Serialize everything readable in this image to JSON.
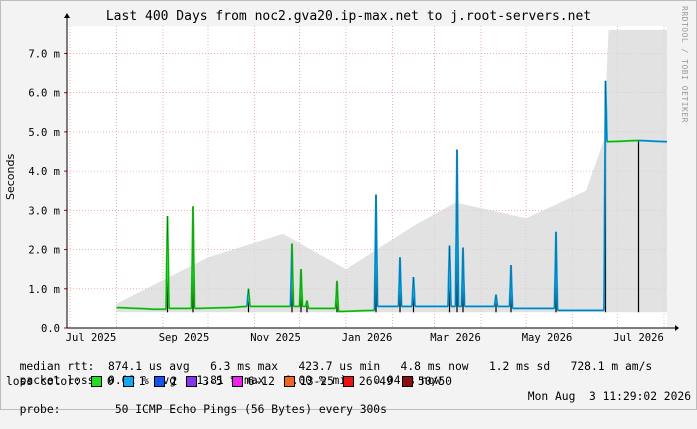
{
  "title": "Last 400 Days from noc2.gva20.ip-max.net to j.root-servers.net",
  "watermark": "RRDTOOL / TOBI OETIKER",
  "stats": {
    "median_rtt": {
      "label": "median rtt:",
      "avg": "874.1 us avg",
      "max": "6.3 ms max",
      "min": "423.7 us min",
      "now": "4.8 ms now",
      "sd": "1.2 ms sd",
      "ams": "728.1 m am/s"
    },
    "packet_loss": {
      "label": "packet loss:",
      "avg": "0.02 % avg",
      "max": "1.81 % max",
      "min": "0.00 % min",
      "now": "0.04 % now"
    }
  },
  "legend": {
    "label": "loss color:",
    "items": [
      {
        "label": "0",
        "color": "#22dd22"
      },
      {
        "label": "1",
        "color": "#11aaee"
      },
      {
        "label": "2",
        "color": "#1155ee"
      },
      {
        "label": "3-5",
        "color": "#8833ee"
      },
      {
        "label": "6-12",
        "color": "#ee22ee"
      },
      {
        "label": "13-25",
        "color": "#ee6622"
      },
      {
        "label": "26-49",
        "color": "#ee1111"
      },
      {
        "label": "50/50",
        "color": "#881111"
      }
    ]
  },
  "probe": {
    "label": "probe:",
    "text": "50 ICMP Echo Pings (56 Bytes) every 300s",
    "date": "Mon Aug  3 11:29:02 2026"
  },
  "chart_data": {
    "type": "line",
    "ylabel": "Seconds",
    "ylim": [
      0,
      7.7
    ],
    "y_unit_scale": 0.001,
    "yticks": [
      {
        "value": 0,
        "label": "0.0"
      },
      {
        "value": 1,
        "label": "1.0 m"
      },
      {
        "value": 2,
        "label": "2.0 m"
      },
      {
        "value": 3,
        "label": "3.0 m"
      },
      {
        "value": 4,
        "label": "4.0 m"
      },
      {
        "value": 5,
        "label": "5.0 m"
      },
      {
        "value": 6,
        "label": "6.0 m"
      },
      {
        "value": 7,
        "label": "7.0 m"
      }
    ],
    "xlim": [
      "2025-06-29",
      "2026-08-03"
    ],
    "xticks": [
      {
        "date": "2025-07-15",
        "label": "Jul 2025"
      },
      {
        "date": "2025-09-15",
        "label": "Sep 2025"
      },
      {
        "date": "2025-11-15",
        "label": "Nov 2025"
      },
      {
        "date": "2026-01-15",
        "label": "Jan 2026"
      },
      {
        "date": "2026-03-15",
        "label": "Mar 2026"
      },
      {
        "date": "2026-05-15",
        "label": "May 2026"
      },
      {
        "date": "2026-07-15",
        "label": "Jul 2026"
      }
    ],
    "grid": true,
    "median_series": [
      {
        "date": "2025-08-01",
        "ms": 0.52,
        "loss": "0"
      },
      {
        "date": "2025-08-15",
        "ms": 0.5,
        "loss": "0"
      },
      {
        "date": "2025-08-25",
        "ms": 0.48,
        "loss": "0"
      },
      {
        "date": "2025-09-03",
        "ms": 0.48,
        "loss": "0"
      },
      {
        "date": "2025-09-04",
        "ms": 2.85,
        "loss": "0"
      },
      {
        "date": "2025-09-05",
        "ms": 0.5,
        "loss": "0"
      },
      {
        "date": "2025-09-20",
        "ms": 0.5,
        "loss": "0"
      },
      {
        "date": "2025-09-21",
        "ms": 3.1,
        "loss": "0"
      },
      {
        "date": "2025-09-22",
        "ms": 0.5,
        "loss": "0"
      },
      {
        "date": "2025-10-15",
        "ms": 0.52,
        "loss": "0"
      },
      {
        "date": "2025-10-27",
        "ms": 0.55,
        "loss": "0"
      },
      {
        "date": "2025-10-28",
        "ms": 1.0,
        "loss": "1"
      },
      {
        "date": "2025-10-29",
        "ms": 0.55,
        "loss": "0"
      },
      {
        "date": "2025-11-25",
        "ms": 0.55,
        "loss": "0"
      },
      {
        "date": "2025-11-26",
        "ms": 2.15,
        "loss": "1"
      },
      {
        "date": "2025-11-27",
        "ms": 0.55,
        "loss": "0"
      },
      {
        "date": "2025-12-01",
        "ms": 0.55,
        "loss": "0"
      },
      {
        "date": "2025-12-02",
        "ms": 1.5,
        "loss": "0"
      },
      {
        "date": "2025-12-03",
        "ms": 0.55,
        "loss": "0"
      },
      {
        "date": "2025-12-05",
        "ms": 0.55,
        "loss": "0"
      },
      {
        "date": "2025-12-06",
        "ms": 0.7,
        "loss": "0"
      },
      {
        "date": "2025-12-07",
        "ms": 0.5,
        "loss": "0"
      },
      {
        "date": "2025-12-25",
        "ms": 0.5,
        "loss": "0"
      },
      {
        "date": "2025-12-26",
        "ms": 1.2,
        "loss": "0"
      },
      {
        "date": "2025-12-27",
        "ms": 0.42,
        "loss": "0"
      },
      {
        "date": "2026-01-20",
        "ms": 0.45,
        "loss": "0"
      },
      {
        "date": "2026-01-21",
        "ms": 3.4,
        "loss": "1"
      },
      {
        "date": "2026-01-22",
        "ms": 0.55,
        "loss": "1"
      },
      {
        "date": "2026-02-05",
        "ms": 0.55,
        "loss": "1"
      },
      {
        "date": "2026-02-06",
        "ms": 1.8,
        "loss": "1"
      },
      {
        "date": "2026-02-07",
        "ms": 0.55,
        "loss": "1"
      },
      {
        "date": "2026-02-14",
        "ms": 0.55,
        "loss": "1"
      },
      {
        "date": "2026-02-15",
        "ms": 1.3,
        "loss": "1"
      },
      {
        "date": "2026-02-16",
        "ms": 0.55,
        "loss": "1"
      },
      {
        "date": "2026-03-10",
        "ms": 0.55,
        "loss": "1"
      },
      {
        "date": "2026-03-11",
        "ms": 2.1,
        "loss": "1"
      },
      {
        "date": "2026-03-12",
        "ms": 0.55,
        "loss": "1"
      },
      {
        "date": "2026-03-15",
        "ms": 0.55,
        "loss": "1"
      },
      {
        "date": "2026-03-16",
        "ms": 4.55,
        "loss": "1"
      },
      {
        "date": "2026-03-17",
        "ms": 0.55,
        "loss": "1"
      },
      {
        "date": "2026-03-19",
        "ms": 0.55,
        "loss": "1"
      },
      {
        "date": "2026-03-20",
        "ms": 2.05,
        "loss": "1"
      },
      {
        "date": "2026-03-21",
        "ms": 0.55,
        "loss": "1"
      },
      {
        "date": "2026-04-10",
        "ms": 0.55,
        "loss": "1"
      },
      {
        "date": "2026-04-11",
        "ms": 0.85,
        "loss": "1"
      },
      {
        "date": "2026-04-12",
        "ms": 0.55,
        "loss": "1"
      },
      {
        "date": "2026-04-20",
        "ms": 0.55,
        "loss": "1"
      },
      {
        "date": "2026-04-21",
        "ms": 1.6,
        "loss": "1"
      },
      {
        "date": "2026-04-22",
        "ms": 0.5,
        "loss": "1"
      },
      {
        "date": "2026-05-20",
        "ms": 0.5,
        "loss": "1"
      },
      {
        "date": "2026-05-21",
        "ms": 2.45,
        "loss": "1"
      },
      {
        "date": "2026-05-22",
        "ms": 0.45,
        "loss": "1"
      },
      {
        "date": "2026-06-22",
        "ms": 0.45,
        "loss": "1"
      },
      {
        "date": "2026-06-23",
        "ms": 6.3,
        "loss": "1"
      },
      {
        "date": "2026-06-24",
        "ms": 4.75,
        "loss": "1"
      },
      {
        "date": "2026-07-15",
        "ms": 4.78,
        "loss": "0"
      },
      {
        "date": "2026-08-03",
        "ms": 4.75,
        "loss": "1"
      }
    ],
    "smoke_upper_ms": [
      {
        "date": "2025-08-01",
        "ms": 0.62
      },
      {
        "date": "2025-10-01",
        "ms": 1.8
      },
      {
        "date": "2025-11-20",
        "ms": 2.4
      },
      {
        "date": "2026-01-01",
        "ms": 1.5
      },
      {
        "date": "2026-02-15",
        "ms": 2.6
      },
      {
        "date": "2026-03-15",
        "ms": 3.2
      },
      {
        "date": "2026-05-01",
        "ms": 2.8
      },
      {
        "date": "2026-06-10",
        "ms": 3.5
      },
      {
        "date": "2026-06-22",
        "ms": 4.8
      },
      {
        "date": "2026-06-25",
        "ms": 7.6
      },
      {
        "date": "2026-08-03",
        "ms": 7.6
      }
    ]
  }
}
